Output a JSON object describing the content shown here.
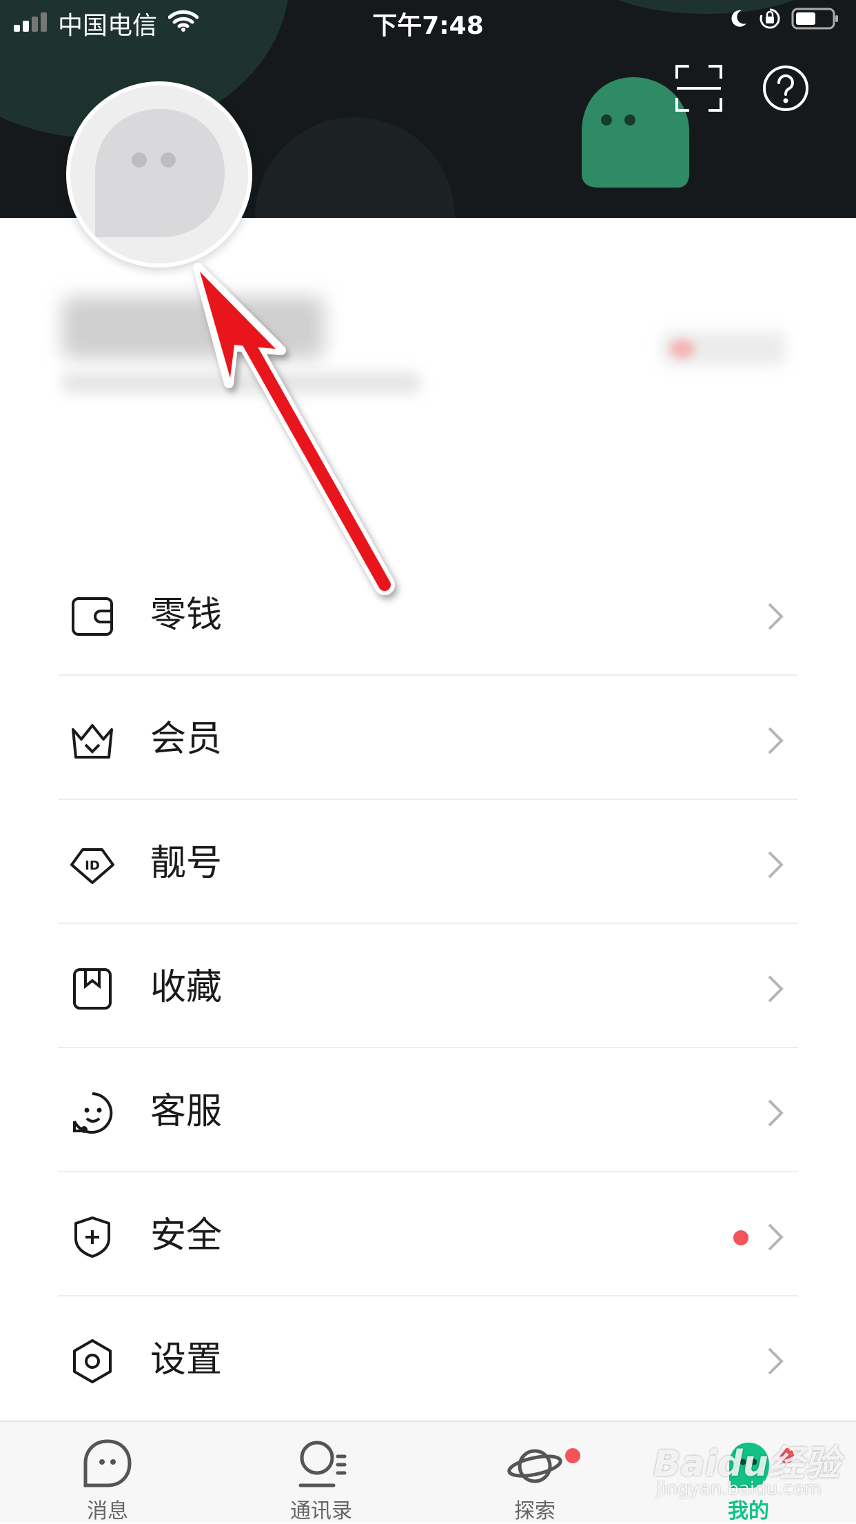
{
  "status_bar": {
    "carrier": "中国电信",
    "time": "下午7:48"
  },
  "header": {
    "scan_icon": "scan-icon",
    "help_icon": "help-icon"
  },
  "profile": {
    "avatar_icon": "ghost-avatar-icon"
  },
  "menu": {
    "items": [
      {
        "label": "零钱",
        "icon": "wallet-icon"
      },
      {
        "label": "会员",
        "icon": "crown-icon"
      },
      {
        "label": "靓号",
        "icon": "id-badge-icon"
      },
      {
        "label": "收藏",
        "icon": "bookmark-icon"
      },
      {
        "label": "客服",
        "icon": "headset-face-icon"
      },
      {
        "label": "安全",
        "icon": "shield-icon",
        "badge": true
      },
      {
        "label": "设置",
        "icon": "hexagon-gear-icon"
      }
    ]
  },
  "tabbar": {
    "tabs": [
      {
        "label": "消息",
        "icon": "chat-bubble-icon"
      },
      {
        "label": "通讯录",
        "icon": "contacts-icon"
      },
      {
        "label": "探索",
        "icon": "planet-icon",
        "badge": true
      },
      {
        "label": "我的",
        "icon": "ghost-icon",
        "badge": true,
        "active": true
      }
    ]
  },
  "watermark": {
    "brand": "Baidu经验",
    "url": "jingyan.baidu.com"
  },
  "colors": {
    "header_bg": "#15191c",
    "accent_green": "#12c185",
    "badge_red": "#f2545b",
    "arrow_red": "#e8141c"
  }
}
